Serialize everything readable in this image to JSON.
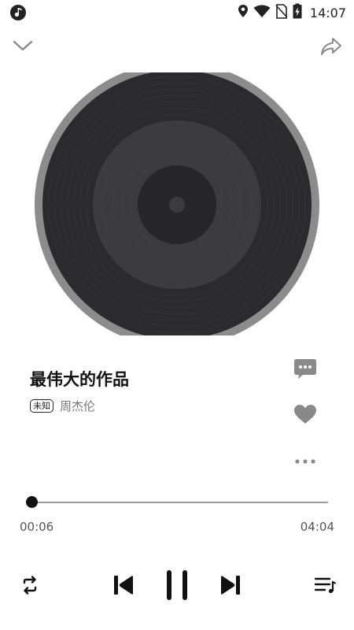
{
  "status_bar": {
    "time": "14:07",
    "icons": [
      "music-app-icon",
      "location-icon",
      "wifi-icon",
      "no-sim-icon",
      "battery-charging-icon"
    ]
  },
  "top_bar": {
    "collapse_icon": "chevron-down-icon",
    "share_icon": "share-icon"
  },
  "song": {
    "title": "最伟大的作品",
    "quality_badge": "未知",
    "artist": "周杰伦"
  },
  "side_actions": [
    "comment-icon",
    "heart-icon",
    "more-icon"
  ],
  "progress": {
    "current": "00:06",
    "total": "04:04",
    "fraction": 0.0
  },
  "controls": [
    "repeat-icon",
    "previous-icon",
    "pause-icon",
    "next-icon",
    "playlist-icon"
  ],
  "colors": {
    "disc_rim": "#8c8c8c",
    "disc_body": "#2b2a2e",
    "disc_label": "#3c3b40",
    "disc_center": "#262529",
    "like_heart": "#888888",
    "comment_bubble": "#8a8a8a"
  }
}
